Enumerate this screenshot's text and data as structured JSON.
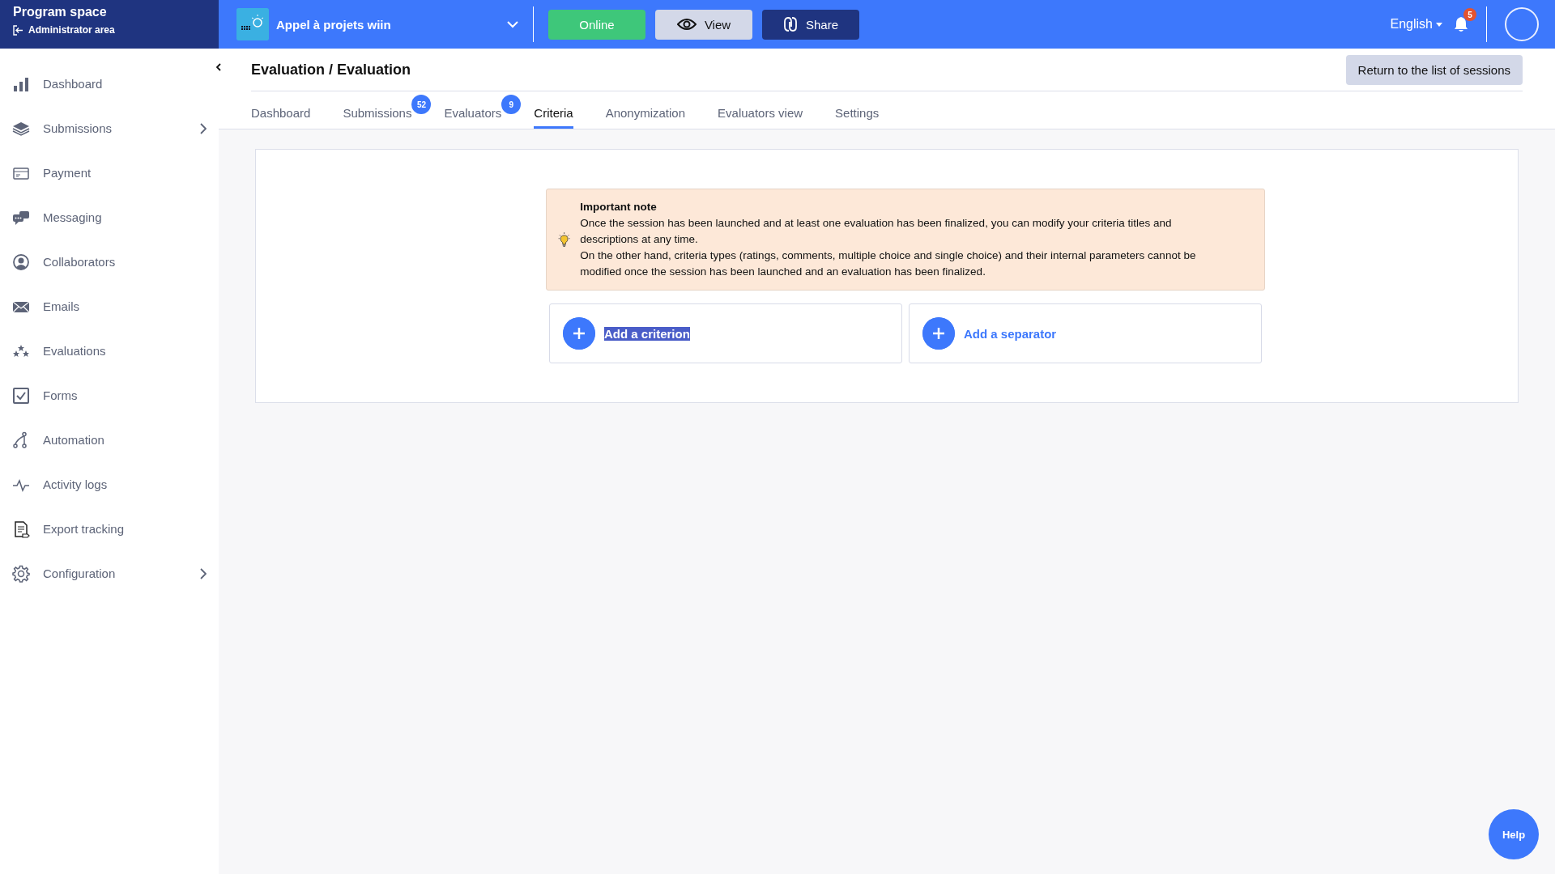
{
  "brand": {
    "title": "Program space",
    "subtitle": "Administrator area"
  },
  "topbar": {
    "project": "Appel à projets wiin",
    "status_button": "Online",
    "view_button": "View",
    "share_button": "Share",
    "language": "English",
    "notification_count": "5"
  },
  "sidebar": {
    "items": [
      {
        "label": "Dashboard",
        "has_submenu": false
      },
      {
        "label": "Submissions",
        "has_submenu": true
      },
      {
        "label": "Payment",
        "has_submenu": false
      },
      {
        "label": "Messaging",
        "has_submenu": false
      },
      {
        "label": "Collaborators",
        "has_submenu": false
      },
      {
        "label": "Emails",
        "has_submenu": false
      },
      {
        "label": "Evaluations",
        "has_submenu": false
      },
      {
        "label": "Forms",
        "has_submenu": false
      },
      {
        "label": "Automation",
        "has_submenu": false
      },
      {
        "label": "Activity logs",
        "has_submenu": false
      },
      {
        "label": "Export tracking",
        "has_submenu": false
      },
      {
        "label": "Configuration",
        "has_submenu": true
      }
    ]
  },
  "page": {
    "title": "Evaluation / Evaluation",
    "return_button": "Return to the list of sessions"
  },
  "tabs": [
    {
      "label": "Dashboard",
      "selected": false
    },
    {
      "label": "Submissions",
      "selected": false,
      "badge": "52"
    },
    {
      "label": "Evaluators",
      "selected": false,
      "badge": "9"
    },
    {
      "label": "Criteria",
      "selected": true
    },
    {
      "label": "Anonymization",
      "selected": false
    },
    {
      "label": "Evaluators view",
      "selected": false
    },
    {
      "label": "Settings",
      "selected": false
    }
  ],
  "note": {
    "title": "Important note",
    "paragraphs": [
      "Once the session has been launched and at least one evaluation has been finalized, you can modify your criteria titles and descriptions at any time.",
      "On the other hand, criteria types (ratings, comments, multiple choice and single choice) and their internal parameters cannot be modified once the session has been launched and an evaluation has been finalized."
    ]
  },
  "actions": [
    {
      "label": "Add a criterion",
      "text_selected": true
    },
    {
      "label": "Add a separator",
      "text_selected": false
    }
  ],
  "help_button": "Help"
}
